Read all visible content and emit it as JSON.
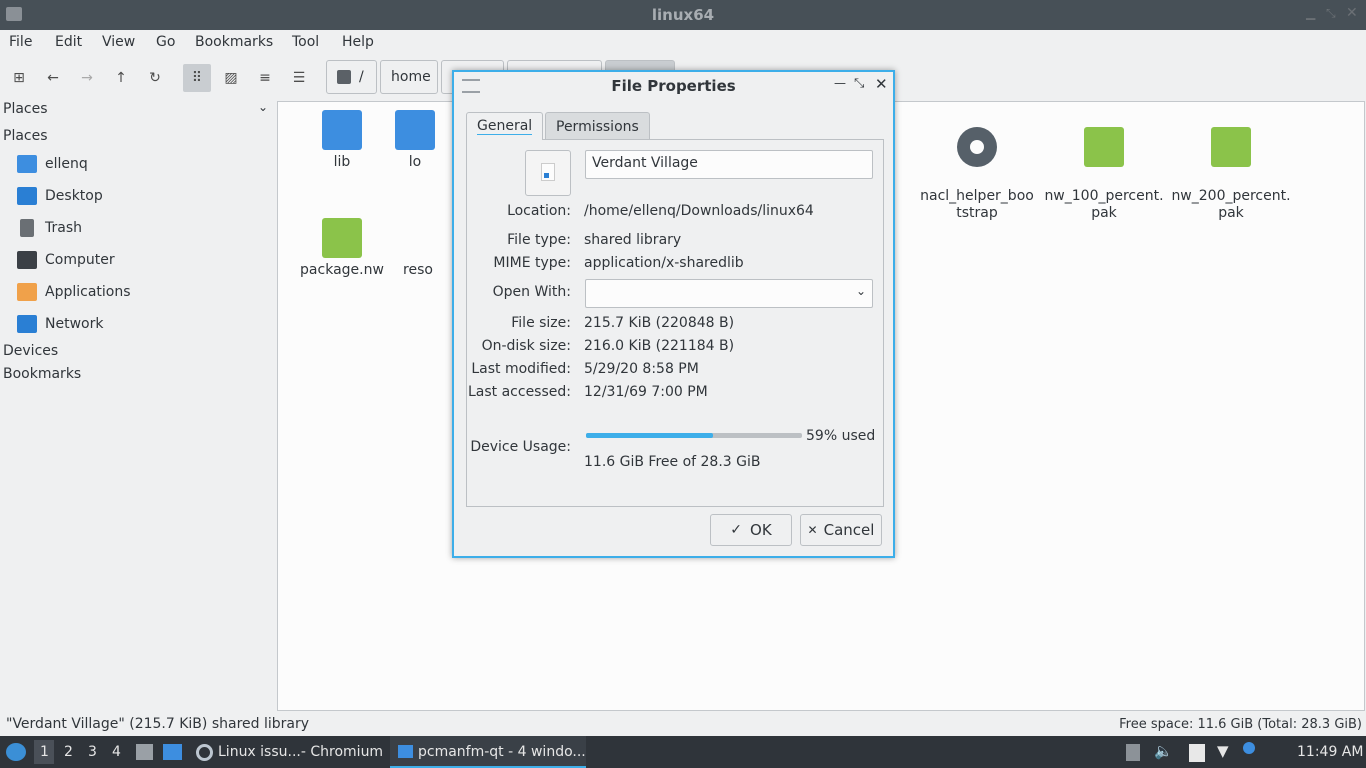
{
  "window": {
    "title": "linux64"
  },
  "menubar": {
    "items": [
      "File",
      "Edit",
      "View",
      "Go",
      "Bookmarks",
      "Tool",
      "Help"
    ]
  },
  "path": {
    "root": "/",
    "home": "home"
  },
  "sidebar": {
    "dropdown_label": "Places",
    "header_places": "Places",
    "items": [
      "ellenq",
      "Desktop",
      "Trash",
      "Computer",
      "Applications",
      "Network"
    ],
    "header_devices": "Devices",
    "header_bookmarks": "Bookmarks"
  },
  "files": [
    {
      "name": "lib",
      "icon": "folder-icon"
    },
    {
      "name": "lo",
      "icon": "folder-icon"
    },
    {
      "name": "nacl_helper_boo\ntstrap",
      "icon": "gear-icon"
    },
    {
      "name": "nw_100_percent.\npak",
      "icon": "archive-icon"
    },
    {
      "name": "nw_200_percent.\npak",
      "icon": "archive-icon"
    },
    {
      "name": "package.nw",
      "icon": "archive-icon"
    },
    {
      "name": "reso",
      "icon": "file-icon"
    }
  ],
  "dialog": {
    "title": "File Properties",
    "tabs": [
      "General",
      "Permissions"
    ],
    "name_value": "Verdant Village",
    "location_label": "Location:",
    "location_value": "/home/ellenq/Downloads/linux64",
    "filetype_label": "File type:",
    "filetype_value": "shared library",
    "mime_label": "MIME type:",
    "mime_value": "application/x-sharedlib",
    "openwith_label": "Open With:",
    "filesize_label": "File size:",
    "filesize_value": "215.7 KiB (220848 B)",
    "ondisk_label": "On-disk size:",
    "ondisk_value": "216.0 KiB (221184 B)",
    "modified_label": "Last modified:",
    "modified_value": "5/29/20 8:58 PM",
    "accessed_label": "Last accessed:",
    "accessed_value": "12/31/69 7:00 PM",
    "usage_label": "Device Usage:",
    "usage_percent_text": "59% used",
    "usage_fraction": 0.59,
    "usage_free_text": "11.6 GiB Free of 28.3 GiB",
    "ok_label": "OK",
    "cancel_label": "Cancel"
  },
  "status": {
    "left": "\"Verdant Village\" (215.7 KiB) shared library",
    "right": "Free space: 11.6 GiB (Total: 28.3 GiB)"
  },
  "taskbar": {
    "desktops": [
      "1",
      "2",
      "3",
      "4"
    ],
    "task1": "Linux issu...- Chromium",
    "task2": "pcmanfm-qt - 4 windo...",
    "clock": "11:49 AM"
  },
  "colors": {
    "accent": "#3daee9",
    "folder": "#3d8ee0",
    "archive": "#8bc34a",
    "taskbar": "#2f343a"
  }
}
